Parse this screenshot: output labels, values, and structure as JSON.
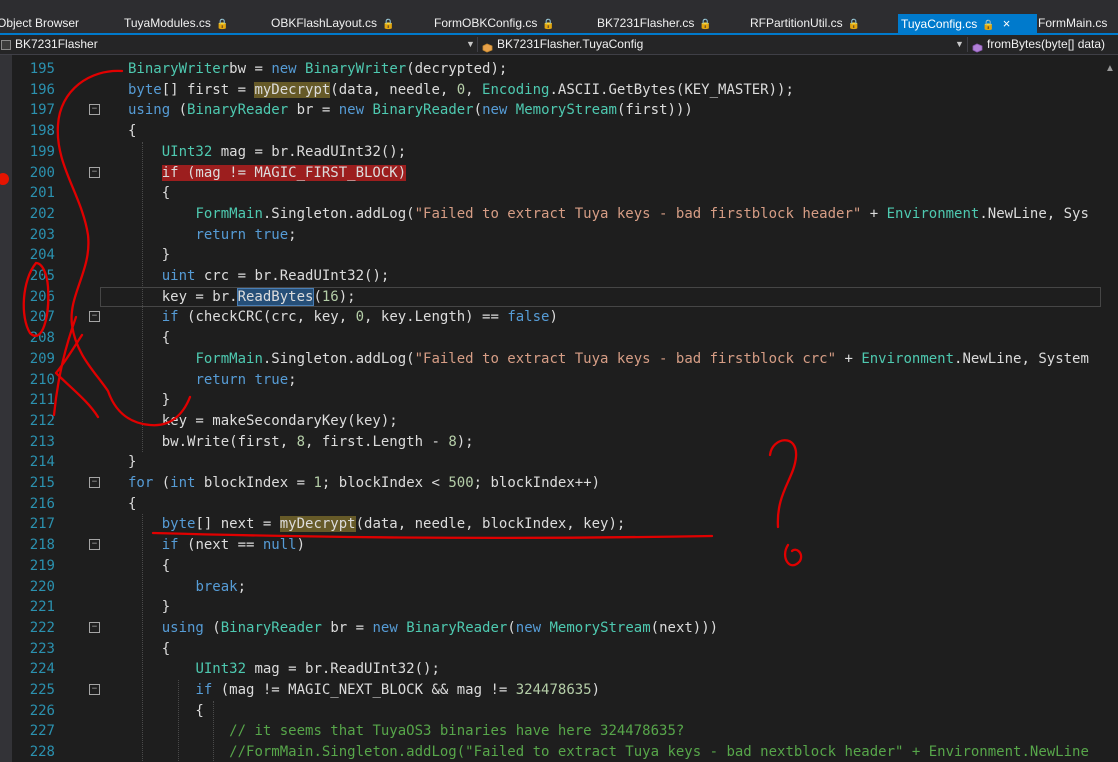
{
  "tabs": [
    {
      "label": "Object Browser",
      "locked": false,
      "active": false
    },
    {
      "label": "TuyaModules.cs",
      "locked": true,
      "active": false
    },
    {
      "label": "OBKFlashLayout.cs",
      "locked": true,
      "active": false
    },
    {
      "label": "FormOBKConfig.cs",
      "locked": true,
      "active": false
    },
    {
      "label": "BK7231Flasher.cs",
      "locked": true,
      "active": false
    },
    {
      "label": "RFPartitionUtil.cs",
      "locked": true,
      "active": false
    },
    {
      "label": "TuyaConfig.cs",
      "locked": true,
      "active": true
    },
    {
      "label": "FormMain.cs",
      "locked": false,
      "active": false
    }
  ],
  "lock_glyph": "🔒",
  "close_glyph": "×",
  "navbar": {
    "project": "BK7231Flasher",
    "class": "BK7231Flasher.TuyaConfig",
    "member": "fromBytes(byte[] data)"
  },
  "annotation": {
    "question_mark": "?",
    "color": "#e00000"
  },
  "colors": {
    "keyword": "#569cd6",
    "type": "#4ec9b0",
    "string": "#d69d85",
    "number": "#b5cea8",
    "comment": "#57a64a",
    "method": "#dcdcaa",
    "line_number": "#2b91af",
    "accent": "#007acc"
  },
  "lines": [
    {
      "num": "195",
      "fold": false,
      "segs": [
        [
          "t",
          "BinaryWriter"
        ],
        [
          "",
          "bw = "
        ],
        [
          "k",
          "new "
        ],
        [
          "t",
          "BinaryWriter"
        ],
        [
          "",
          "(decrypted);"
        ]
      ]
    },
    {
      "num": "196",
      "fold": false,
      "segs": [
        [
          "k",
          "byte"
        ],
        [
          "",
          "[] first = "
        ],
        [
          "hl",
          "myDecrypt"
        ],
        [
          "",
          "(data, needle, "
        ],
        [
          "n",
          "0"
        ],
        [
          "",
          ", "
        ],
        [
          "t",
          "Encoding"
        ],
        [
          "",
          ".ASCII.GetBytes(KEY_MASTER));"
        ]
      ]
    },
    {
      "num": "197",
      "fold": true,
      "segs": [
        [
          "k",
          "using "
        ],
        [
          "",
          "("
        ],
        [
          "t",
          "BinaryReader"
        ],
        [
          "",
          " br = "
        ],
        [
          "k",
          "new "
        ],
        [
          "t",
          "BinaryReader"
        ],
        [
          "",
          "("
        ],
        [
          "k",
          "new "
        ],
        [
          "t",
          "MemoryStream"
        ],
        [
          "",
          "(first)))"
        ]
      ]
    },
    {
      "num": "198",
      "fold": false,
      "segs": [
        [
          "",
          "{"
        ]
      ]
    },
    {
      "num": "199",
      "fold": false,
      "segs": [
        [
          "",
          "    "
        ],
        [
          "t",
          "UInt32"
        ],
        [
          "",
          " mag = br.ReadUInt32();"
        ]
      ]
    },
    {
      "num": "200",
      "fold": true,
      "segs": [
        [
          "",
          "    "
        ],
        [
          "bp",
          "if (mag != MAGIC_FIRST_BLOCK)"
        ]
      ]
    },
    {
      "num": "201",
      "fold": false,
      "segs": [
        [
          "",
          "    {"
        ]
      ]
    },
    {
      "num": "202",
      "fold": false,
      "segs": [
        [
          "",
          "        "
        ],
        [
          "t",
          "FormMain"
        ],
        [
          "",
          ".Singleton.addLog("
        ],
        [
          "s",
          "\"Failed to extract Tuya keys - bad firstblock header\""
        ],
        [
          "",
          " + "
        ],
        [
          "t",
          "Environment"
        ],
        [
          "",
          ".NewLine, Sys"
        ]
      ]
    },
    {
      "num": "203",
      "fold": false,
      "segs": [
        [
          "",
          "        "
        ],
        [
          "k",
          "return true"
        ],
        [
          "",
          ";"
        ]
      ]
    },
    {
      "num": "204",
      "fold": false,
      "segs": [
        [
          "",
          "    }"
        ]
      ]
    },
    {
      "num": "205",
      "fold": false,
      "segs": [
        [
          "",
          "    "
        ],
        [
          "k",
          "uint"
        ],
        [
          "",
          " crc = br.ReadUInt32();"
        ]
      ]
    },
    {
      "num": "206",
      "fold": false,
      "segs": [
        [
          "",
          "    key = br."
        ],
        [
          "sel",
          "ReadBytes"
        ],
        [
          "",
          "("
        ],
        [
          "n",
          "16"
        ],
        [
          "",
          ");"
        ]
      ]
    },
    {
      "num": "207",
      "fold": true,
      "segs": [
        [
          "",
          "    "
        ],
        [
          "k",
          "if "
        ],
        [
          "",
          "(checkCRC(crc, key, "
        ],
        [
          "n",
          "0"
        ],
        [
          "",
          ", key.Length) == "
        ],
        [
          "k",
          "false"
        ],
        [
          "",
          ")"
        ]
      ]
    },
    {
      "num": "208",
      "fold": false,
      "segs": [
        [
          "",
          "    {"
        ]
      ]
    },
    {
      "num": "209",
      "fold": false,
      "segs": [
        [
          "",
          "        "
        ],
        [
          "t",
          "FormMain"
        ],
        [
          "",
          ".Singleton.addLog("
        ],
        [
          "s",
          "\"Failed to extract Tuya keys - bad firstblock crc\""
        ],
        [
          "",
          " + "
        ],
        [
          "t",
          "Environment"
        ],
        [
          "",
          ".NewLine, System"
        ]
      ]
    },
    {
      "num": "210",
      "fold": false,
      "segs": [
        [
          "",
          "        "
        ],
        [
          "k",
          "return true"
        ],
        [
          "",
          ";"
        ]
      ]
    },
    {
      "num": "211",
      "fold": false,
      "segs": [
        [
          "",
          "    }"
        ]
      ]
    },
    {
      "num": "212",
      "fold": false,
      "segs": [
        [
          "",
          "    key = makeSecondaryKey(key);"
        ]
      ]
    },
    {
      "num": "213",
      "fold": false,
      "segs": [
        [
          "",
          "    bw.Write(first, "
        ],
        [
          "n",
          "8"
        ],
        [
          "",
          ", first.Length - "
        ],
        [
          "n",
          "8"
        ],
        [
          "",
          ");"
        ]
      ]
    },
    {
      "num": "214",
      "fold": false,
      "segs": [
        [
          "",
          "}"
        ]
      ]
    },
    {
      "num": "215",
      "fold": true,
      "segs": [
        [
          "k",
          "for "
        ],
        [
          "",
          "("
        ],
        [
          "k",
          "int"
        ],
        [
          "",
          " blockIndex = "
        ],
        [
          "n",
          "1"
        ],
        [
          "",
          "; blockIndex < "
        ],
        [
          "n",
          "500"
        ],
        [
          "",
          "; blockIndex++)"
        ]
      ]
    },
    {
      "num": "216",
      "fold": false,
      "segs": [
        [
          "",
          "{"
        ]
      ]
    },
    {
      "num": "217",
      "fold": false,
      "segs": [
        [
          "",
          "    "
        ],
        [
          "k",
          "byte"
        ],
        [
          "",
          "[] next = "
        ],
        [
          "hl",
          "myDecrypt"
        ],
        [
          "",
          "(data, needle, blockIndex, key);"
        ]
      ]
    },
    {
      "num": "218",
      "fold": true,
      "segs": [
        [
          "",
          "    "
        ],
        [
          "k",
          "if "
        ],
        [
          "",
          "(next == "
        ],
        [
          "k",
          "null"
        ],
        [
          "",
          ")"
        ]
      ]
    },
    {
      "num": "219",
      "fold": false,
      "segs": [
        [
          "",
          "    {"
        ]
      ]
    },
    {
      "num": "220",
      "fold": false,
      "segs": [
        [
          "",
          "        "
        ],
        [
          "k",
          "break"
        ],
        [
          "",
          ";"
        ]
      ]
    },
    {
      "num": "221",
      "fold": false,
      "segs": [
        [
          "",
          "    }"
        ]
      ]
    },
    {
      "num": "222",
      "fold": true,
      "segs": [
        [
          "",
          "    "
        ],
        [
          "k",
          "using "
        ],
        [
          "",
          "("
        ],
        [
          "t",
          "BinaryReader"
        ],
        [
          "",
          " br = "
        ],
        [
          "k",
          "new "
        ],
        [
          "t",
          "BinaryReader"
        ],
        [
          "",
          "("
        ],
        [
          "k",
          "new "
        ],
        [
          "t",
          "MemoryStream"
        ],
        [
          "",
          "(next)))"
        ]
      ]
    },
    {
      "num": "223",
      "fold": false,
      "segs": [
        [
          "",
          "    {"
        ]
      ]
    },
    {
      "num": "224",
      "fold": false,
      "segs": [
        [
          "",
          "        "
        ],
        [
          "t",
          "UInt32"
        ],
        [
          "",
          " mag = br.ReadUInt32();"
        ]
      ]
    },
    {
      "num": "225",
      "fold": true,
      "segs": [
        [
          "",
          "        "
        ],
        [
          "k",
          "if "
        ],
        [
          "",
          "(mag != MAGIC_NEXT_BLOCK && mag != "
        ],
        [
          "n",
          "324478635"
        ],
        [
          "",
          ")"
        ]
      ]
    },
    {
      "num": "226",
      "fold": false,
      "segs": [
        [
          "",
          "        {"
        ]
      ]
    },
    {
      "num": "227",
      "fold": false,
      "segs": [
        [
          "",
          "            "
        ],
        [
          "c",
          "// it seems that TuyaOS3 binaries have here 324478635?"
        ]
      ]
    },
    {
      "num": "228",
      "fold": false,
      "segs": [
        [
          "",
          "            "
        ],
        [
          "c",
          "//FormMain.Singleton.addLog(\"Failed to extract Tuya keys - bad nextblock header\" + Environment.NewLine"
        ]
      ]
    }
  ]
}
